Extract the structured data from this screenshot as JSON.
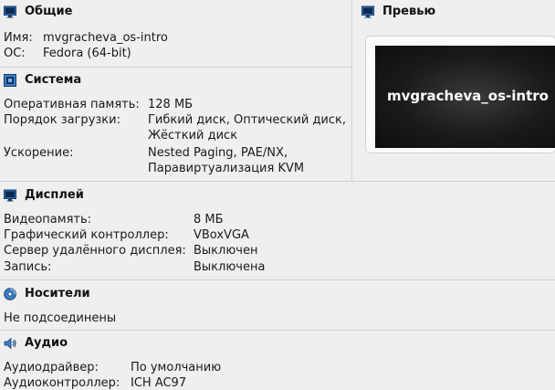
{
  "general": {
    "title": "Общие",
    "name_label": "Имя:",
    "name_value": "mvgracheva_os-intro",
    "os_label": "ОС:",
    "os_value": "Fedora (64-bit)"
  },
  "preview": {
    "title": "Превью",
    "vm_name": "mvgracheva_os-intro"
  },
  "system": {
    "title": "Система",
    "ram_label": "Оперативная память:",
    "ram_value": "128 МБ",
    "boot_label": "Порядок загрузки:",
    "boot_value_1": "Гибкий диск, Оптический диск,",
    "boot_value_2": "Жёсткий диск",
    "accel_label": "Ускорение:",
    "accel_value_1": "Nested Paging, PAE/NX,",
    "accel_value_2": "Паравиртуализация KVM"
  },
  "display": {
    "title": "Дисплей",
    "vram_label": "Видеопамять:",
    "vram_value": "8 МБ",
    "controller_label": "Графический контроллер:",
    "controller_value": "VBoxVGA",
    "rds_label": "Сервер удалённого дисплея:",
    "rds_value": "Выключен",
    "recording_label": "Запись:",
    "recording_value": "Выключена"
  },
  "storage": {
    "title": "Носители",
    "status": "Не подсоединены"
  },
  "audio": {
    "title": "Аудио",
    "driver_label": "Аудиодрайвер:",
    "driver_value": "По умолчанию",
    "controller_label": "Аудиоконтроллер:",
    "controller_value": "ICH AC97"
  },
  "icons": {
    "general": "monitor-icon",
    "preview": "monitor-icon",
    "system": "chip-icon",
    "display": "monitor-icon",
    "storage": "disc-icon",
    "audio": "speaker-icon"
  },
  "colors": {
    "accent_blue": "#2a6ebd",
    "background": "#efefef",
    "divider": "#cfcfcf"
  }
}
